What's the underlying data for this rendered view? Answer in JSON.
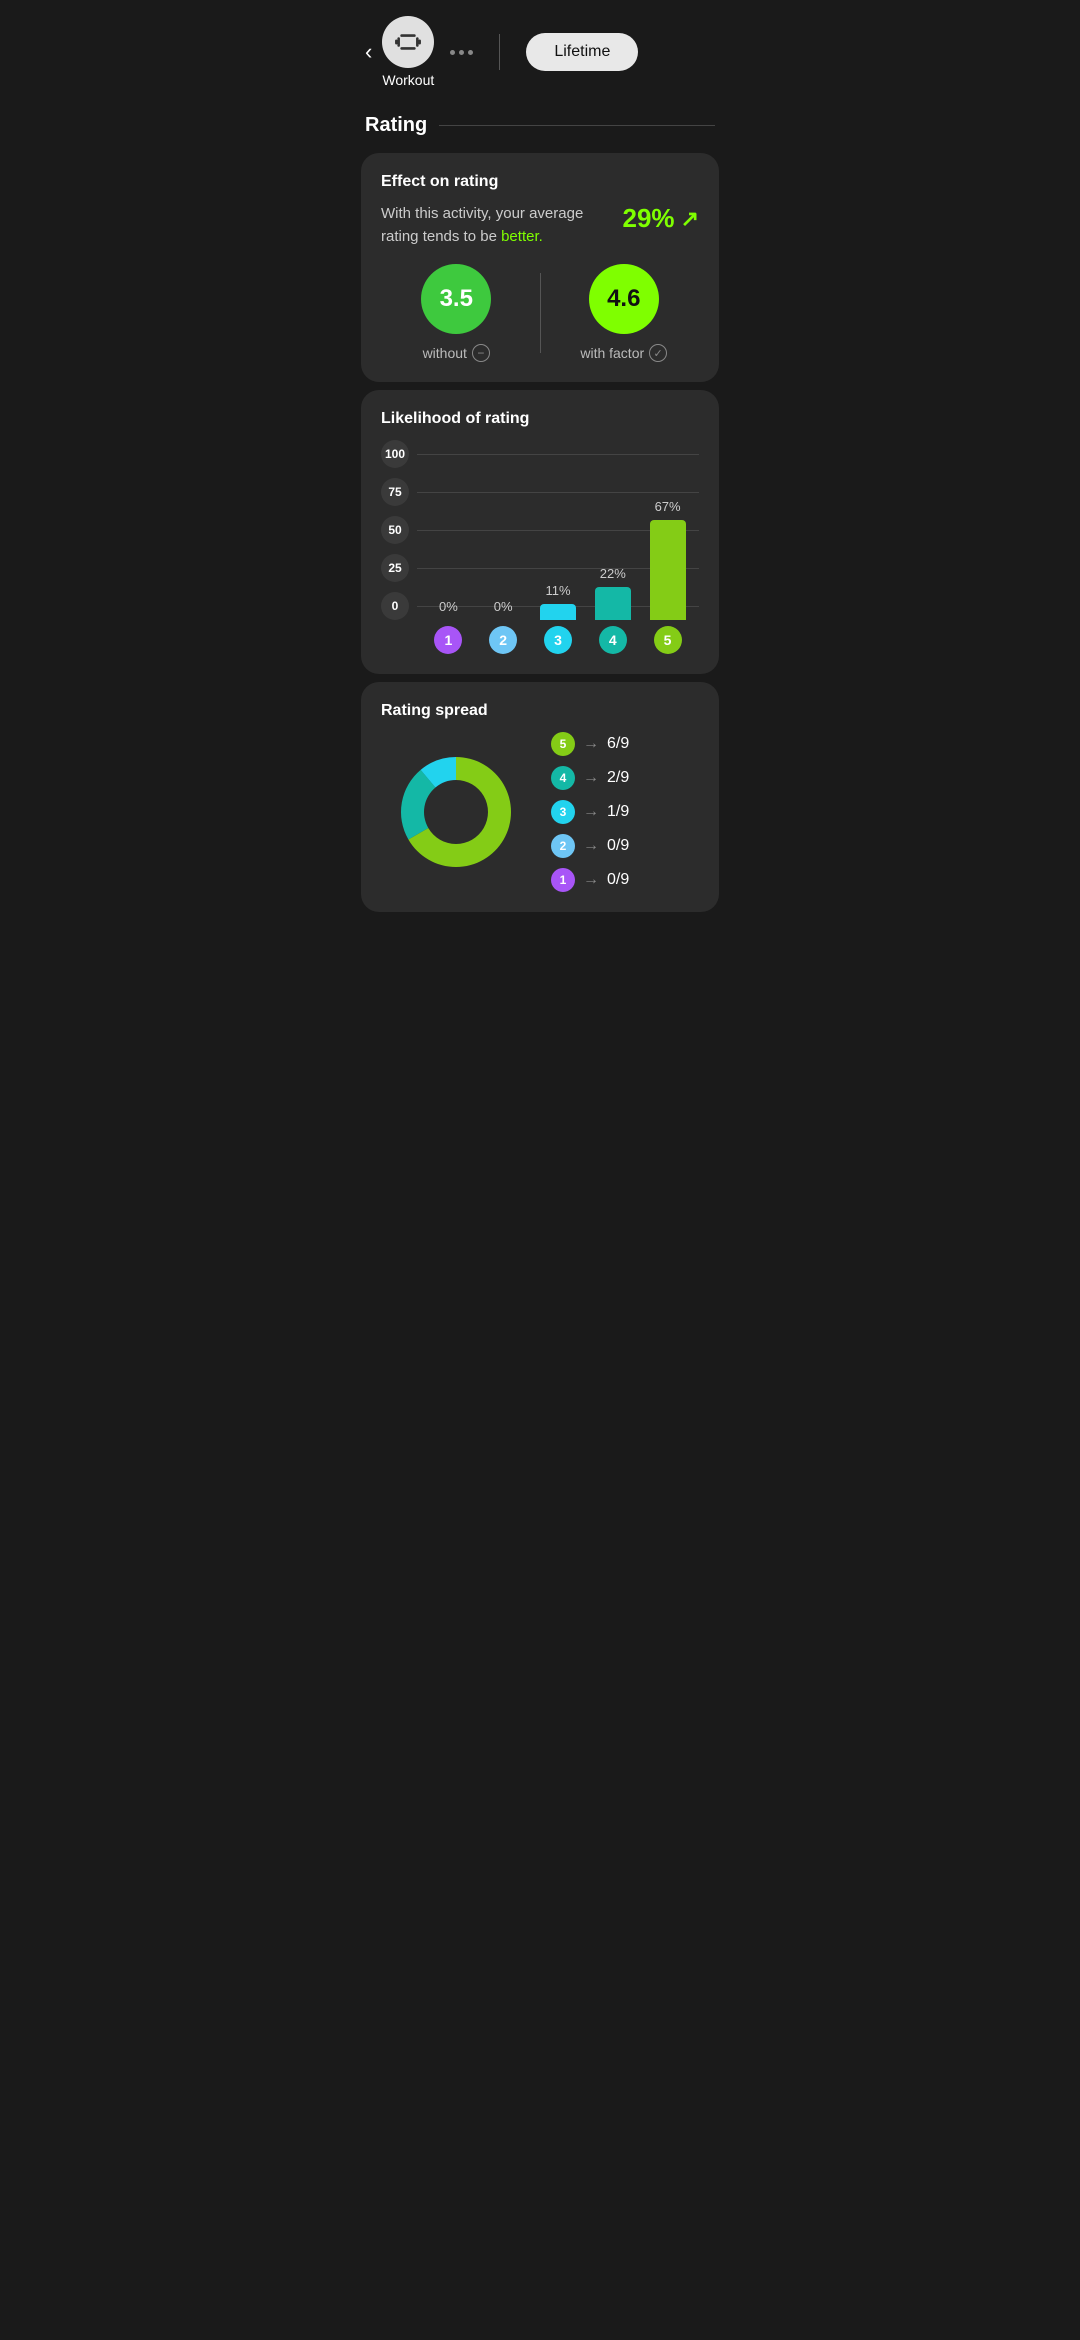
{
  "header": {
    "back_label": "‹",
    "workout_label": "Workout",
    "dots": [
      "•",
      "•",
      "•"
    ],
    "lifetime_label": "Lifetime"
  },
  "rating_section": {
    "title": "Rating"
  },
  "effect_card": {
    "title": "Effect on rating",
    "description_start": "With this activity, your average rating tends to be ",
    "better_word": "better.",
    "percent": "29%",
    "without_value": "3.5",
    "without_label": "without",
    "with_value": "4.6",
    "with_label": "with factor"
  },
  "likelihood_card": {
    "title": "Likelihood of rating",
    "y_labels": [
      "100",
      "75",
      "50",
      "25",
      "0"
    ],
    "bars": [
      {
        "rating": 1,
        "pct_label": "0%",
        "pct": 0,
        "color": "purple"
      },
      {
        "rating": 2,
        "pct_label": "0%",
        "pct": 0,
        "color": "blue-light"
      },
      {
        "rating": 3,
        "pct_label": "11%",
        "pct": 11,
        "color": "cyan"
      },
      {
        "rating": 4,
        "pct_label": "22%",
        "pct": 22,
        "color": "teal"
      },
      {
        "rating": 5,
        "pct_label": "67%",
        "pct": 67,
        "color": "lime"
      }
    ]
  },
  "spread_card": {
    "title": "Rating spread",
    "segments": [
      {
        "rating": 5,
        "count": 6,
        "total": 9,
        "color": "#84cc16"
      },
      {
        "rating": 4,
        "count": 2,
        "total": 9,
        "color": "#14b8a6"
      },
      {
        "rating": 3,
        "count": 1,
        "total": 9,
        "color": "#22d3ee"
      },
      {
        "rating": 2,
        "count": 0,
        "total": 9,
        "color": "#6ec6f5"
      },
      {
        "rating": 1,
        "count": 0,
        "total": 9,
        "color": "#a855f7"
      }
    ]
  }
}
